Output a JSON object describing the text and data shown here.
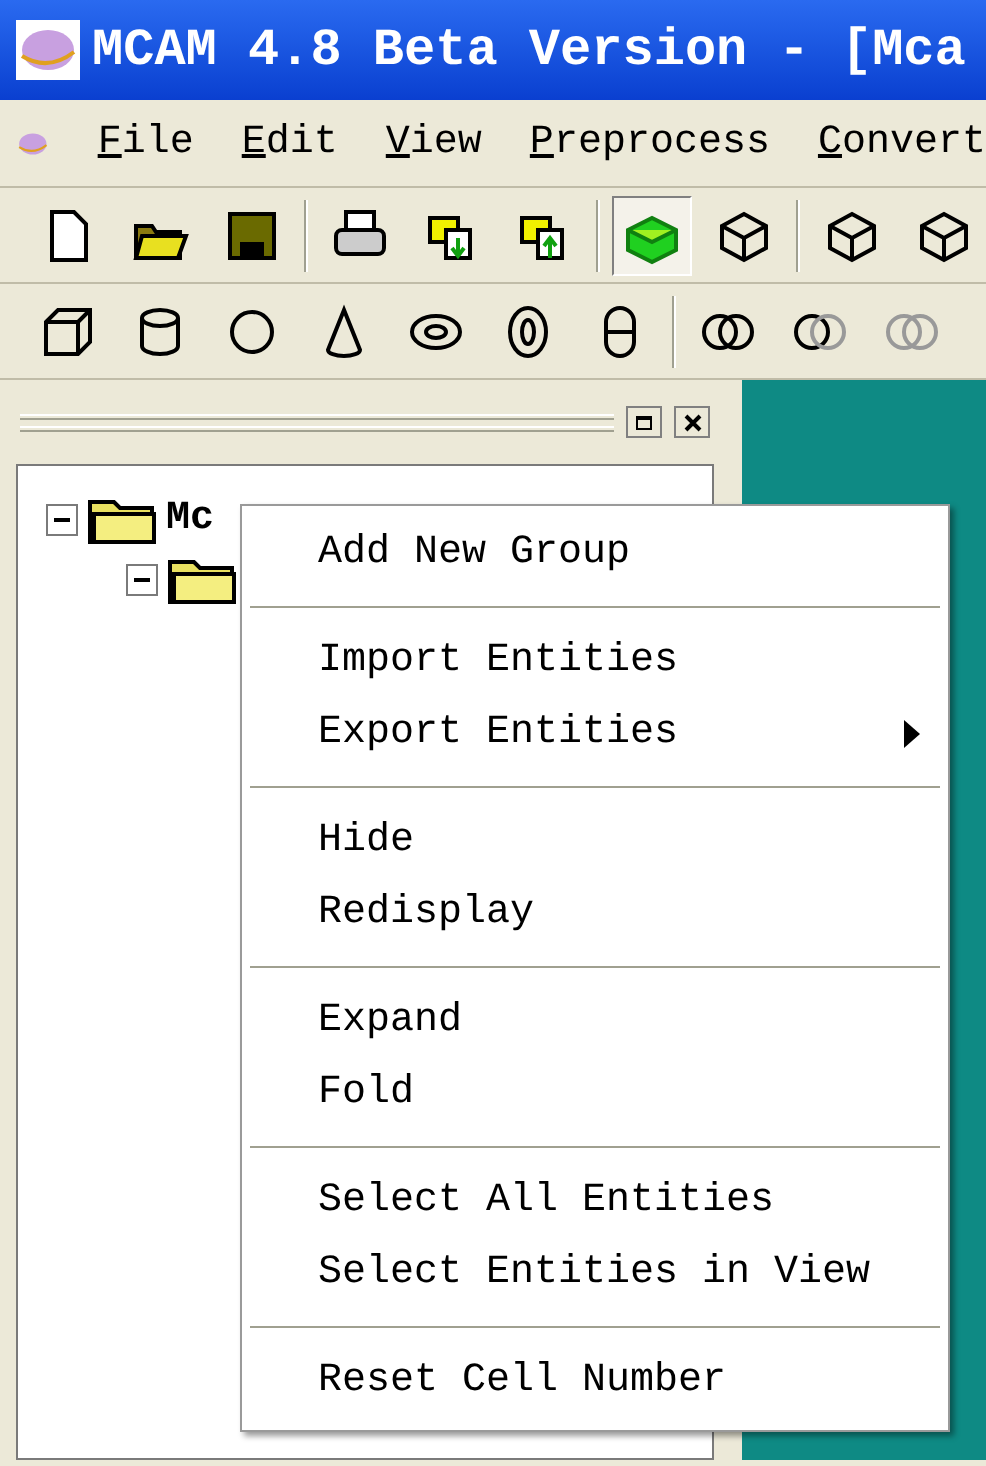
{
  "window": {
    "title": "MCAM 4.8 Beta Version - [Mca"
  },
  "menu_bar": [
    "File",
    "Edit",
    "View",
    "Preprocess",
    "Convert"
  ],
  "toolbars": [
    {
      "buttons": [
        {
          "selected": false
        },
        {
          "selected": false
        },
        {
          "selected": false
        },
        {
          "selected": false
        },
        {
          "selected": false
        },
        {
          "selected": false
        },
        {
          "selected": true
        },
        {
          "selected": false
        },
        {
          "selected": false
        },
        {
          "selected": false
        }
      ]
    },
    {
      "buttons": [
        {
          "selected": false
        },
        {
          "selected": false
        },
        {
          "selected": false
        },
        {
          "selected": false
        },
        {
          "selected": false
        },
        {
          "selected": false
        },
        {
          "selected": false
        },
        {
          "selected": false
        },
        {
          "selected": false
        },
        {
          "selected": false
        }
      ]
    }
  ],
  "tree": [
    {
      "label": "Mc",
      "expanded": true,
      "children": [
        {
          "expanded": true
        }
      ]
    }
  ],
  "context_menu": [
    {
      "kind": "item",
      "label": "Add New Group"
    },
    {
      "kind": "separator"
    },
    {
      "kind": "item",
      "label": "Import Entities"
    },
    {
      "kind": "item",
      "label": "Export Entities",
      "submenu": true
    },
    {
      "kind": "separator"
    },
    {
      "kind": "item",
      "label": "Hide"
    },
    {
      "kind": "item",
      "label": "Redisplay"
    },
    {
      "kind": "separator"
    },
    {
      "kind": "item",
      "label": "Expand"
    },
    {
      "kind": "item",
      "label": "Fold"
    },
    {
      "kind": "separator"
    },
    {
      "kind": "item",
      "label": "Select All Entities"
    },
    {
      "kind": "item",
      "label": "Select Entities in View"
    },
    {
      "kind": "separator"
    },
    {
      "kind": "item",
      "label": "Reset Cell Number"
    }
  ]
}
